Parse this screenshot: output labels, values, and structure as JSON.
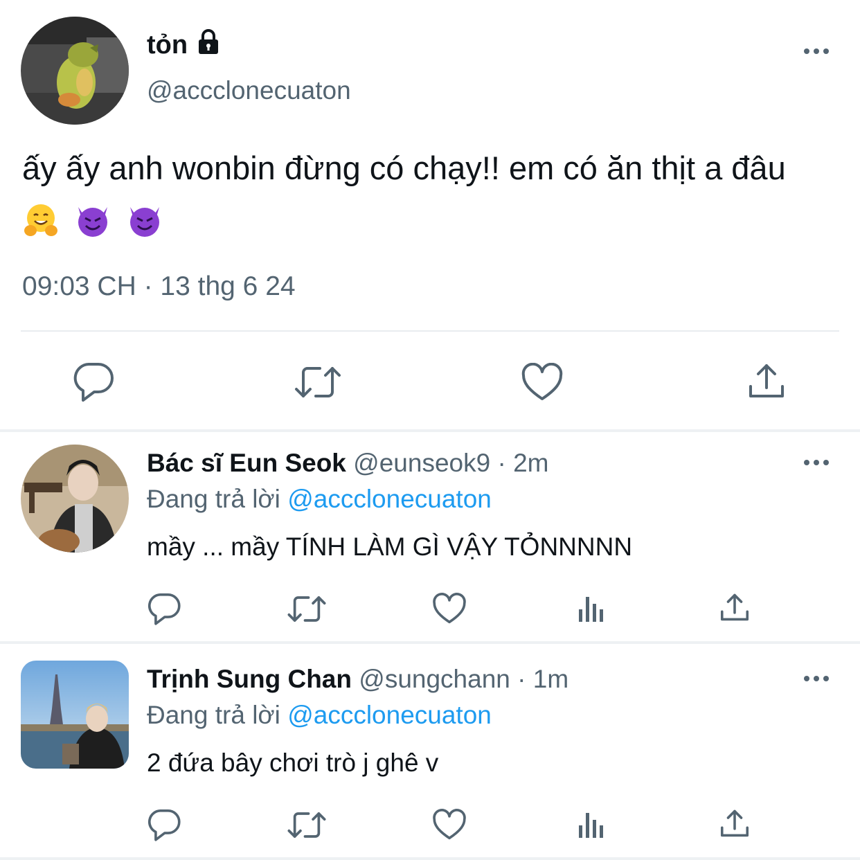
{
  "main_tweet": {
    "author_name": "tỏn",
    "handle": "@accclonecuaton",
    "text": "ấy ấy anh wonbin đừng có chạy!! em có ăn thịt a đâu",
    "emojis": [
      "hugging-face",
      "smiling-devil",
      "smiling-devil"
    ],
    "timestamp": "09:03 CH · 13 thg 6 24",
    "locked": true
  },
  "replies": [
    {
      "author_name": "Bác sĩ Eun Seok",
      "handle": "@eunseok9",
      "time": " · 2m",
      "replying_label": "Đang trả lời ",
      "replying_to": "@accclonecuaton",
      "text": "mầy ... mầy TÍNH LÀM GÌ VẬY TỎNNNNN"
    },
    {
      "author_name": "Trịnh Sung Chan",
      "handle": "@sungchann",
      "time": " · 1m",
      "replying_label": "Đang trả lời ",
      "replying_to": "@accclonecuaton",
      "text": "2 đứa bây chơi trò j ghê v"
    }
  ],
  "colors": {
    "text": "#0f1419",
    "secondary": "#536471",
    "link": "#1d9bf0",
    "divider": "#e8ecef"
  }
}
